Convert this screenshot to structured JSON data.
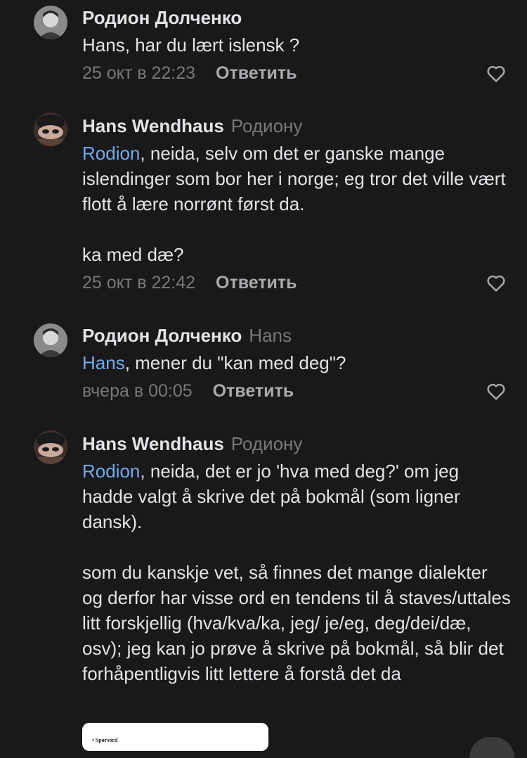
{
  "comments": [
    {
      "author": "Родион Долченко",
      "reply_to": "",
      "mention": "",
      "text": "Hans, har du lært islensk ?",
      "time": "25 окт в 22:23",
      "reply_label": "Ответить"
    },
    {
      "author": "Hans Wendhaus",
      "reply_to": "Родиону",
      "mention": "Rodion",
      "text": ", neida, selv om det er ganske mange islendinger som bor her i norge; eg tror det ville vært flott å lære norrønt først da.\n\nka med dæ?",
      "time": "25 окт в 22:42",
      "reply_label": "Ответить"
    },
    {
      "author": "Родион Долченко",
      "reply_to": "Hans",
      "mention": "Hans",
      "text": ", mener du \"kan med deg\"?",
      "time": "вчера в 00:05",
      "reply_label": "Ответить"
    },
    {
      "author": "Hans Wendhaus",
      "reply_to": "Родиону",
      "mention": "Rodion",
      "text": ", neida, det er jo 'hva med deg?' om jeg hadde valgt å skrive det på bokmål (som ligner dansk).\n\nsom du kanskje vet, så finnes det mange dialekter og derfor har visse ord en tendens til å staves/uttales litt forskjellig (hva/kva/ka, jeg/ je/eg, deg/dei/dæ, osv); jeg kan jo prøve å skrive på bokmål, så blir det forhåpentligvis litt lettere å forstå det da",
      "time": "",
      "reply_label": ""
    }
  ],
  "attachment": {
    "text": "• Spørsord"
  },
  "colors": {
    "background": "#19191a",
    "text": "#e1e3e6",
    "muted": "#76787a",
    "mention": "#71aaeb"
  },
  "icons": {
    "like": "heart-outline-icon"
  }
}
